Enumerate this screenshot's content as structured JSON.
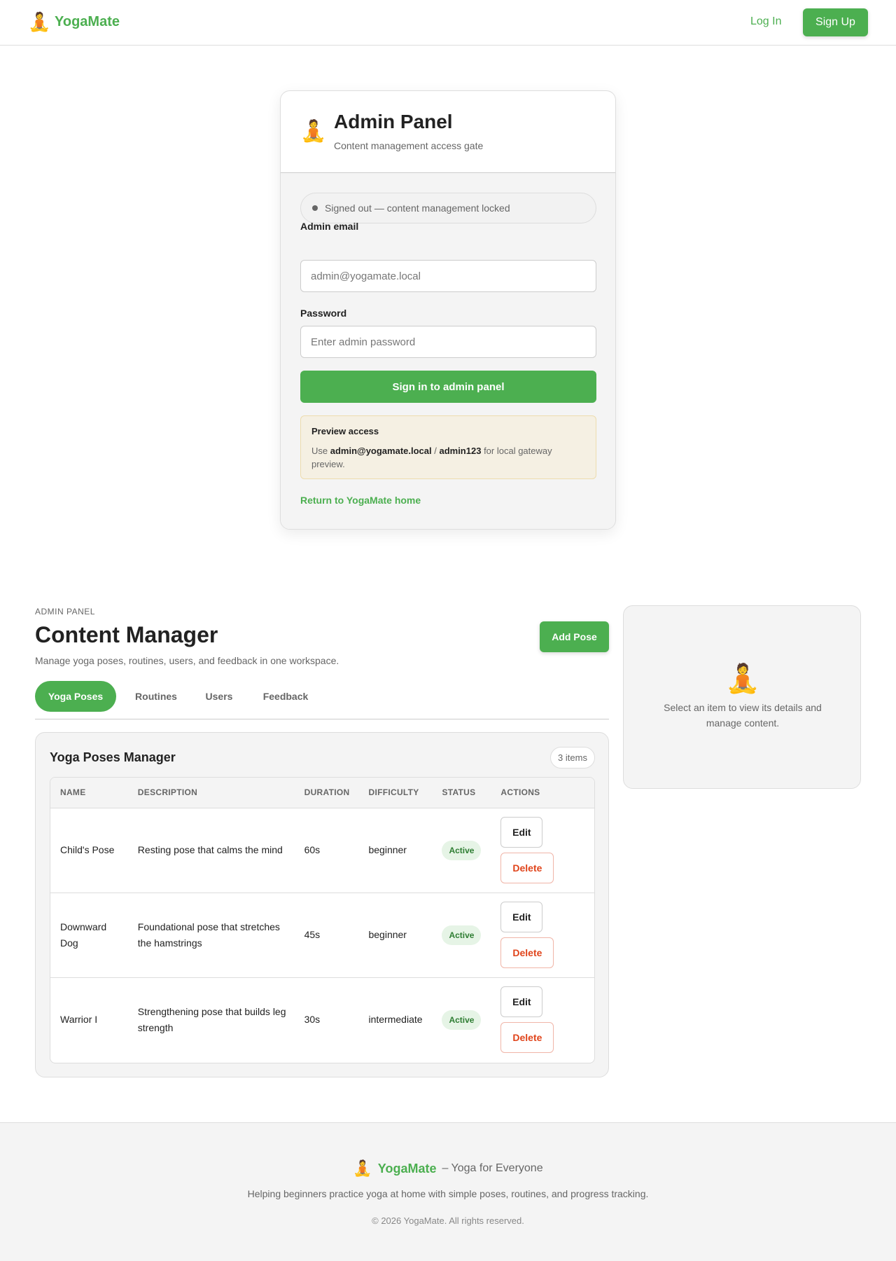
{
  "header": {
    "brand_icon": "🧘",
    "brand_name": "YogaMate",
    "login_label": "Log In",
    "signup_label": "Sign Up"
  },
  "auth": {
    "icon": "🧘",
    "title": "Admin Panel",
    "subtitle": "Content management access gate",
    "status_text": "Signed out — content management locked",
    "email_label": "Admin email",
    "email_placeholder": "admin@yogamate.local",
    "password_label": "Password",
    "password_placeholder": "Enter admin password",
    "signin_label": "Sign in to admin panel",
    "preview_title": "Preview access",
    "preview_prefix": "Use ",
    "preview_email": "admin@yogamate.local",
    "preview_sep": " / ",
    "preview_password": "admin123",
    "preview_suffix": " for local gateway preview.",
    "return_link": "Return to YogaMate home"
  },
  "manager": {
    "eyebrow": "ADMIN PANEL",
    "title": "Content Manager",
    "subtitle": "Manage yoga poses, routines, users, and feedback in one workspace.",
    "add_label": "Add Pose",
    "tabs": [
      {
        "label": "Yoga Poses"
      },
      {
        "label": "Routines"
      },
      {
        "label": "Users"
      },
      {
        "label": "Feedback"
      }
    ],
    "panel_title": "Yoga Poses Manager",
    "count": "3 items",
    "columns": [
      "NAME",
      "DESCRIPTION",
      "DURATION",
      "DIFFICULTY",
      "STATUS",
      "ACTIONS"
    ],
    "rows": [
      {
        "name": "Child's Pose",
        "description": "Resting pose that calms the mind",
        "duration": "60s",
        "difficulty": "beginner",
        "status": "Active",
        "edit": "Edit",
        "delete": "Delete"
      },
      {
        "name": "Downward Dog",
        "description": "Foundational pose that stretches the hamstrings",
        "duration": "45s",
        "difficulty": "beginner",
        "status": "Active",
        "edit": "Edit",
        "delete": "Delete"
      },
      {
        "name": "Warrior I",
        "description": "Strengthening pose that builds leg strength",
        "duration": "30s",
        "difficulty": "intermediate",
        "status": "Active",
        "edit": "Edit",
        "delete": "Delete"
      }
    ]
  },
  "detail": {
    "icon": "🧘",
    "text": "Select an item to view its details and manage content."
  },
  "footer": {
    "icon": "🧘",
    "name": "YogaMate",
    "tagline": "– Yoga for Everyone",
    "description": "Helping beginners practice yoga at home with simple poses, routines, and progress tracking.",
    "copyright": "© 2026 YogaMate. All rights reserved."
  },
  "colors": {
    "accent": "#4caf50",
    "danger": "#e0441b",
    "status_bg": "#e6f4e6",
    "preview_bg": "#f5f0e3"
  },
  "icons": {
    "brand": "meditation-icon",
    "status_dot": "status-dot-icon"
  }
}
